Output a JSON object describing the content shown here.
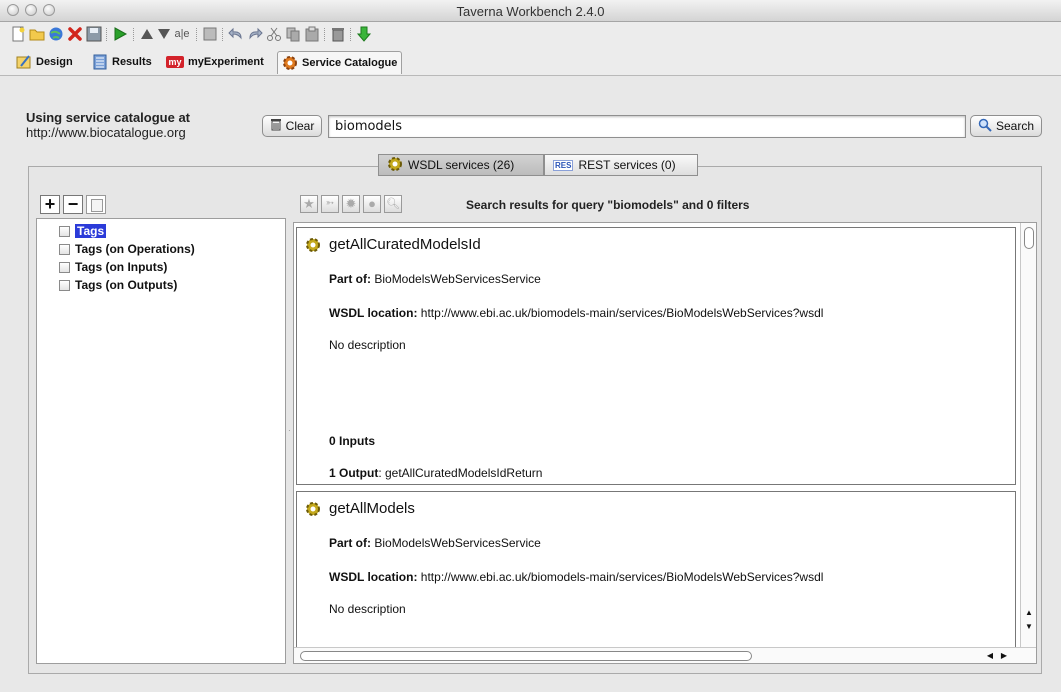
{
  "window": {
    "title": "Taverna Workbench 2.4.0"
  },
  "toolbar": {
    "icons": [
      "new-workflow-icon",
      "open-folder-icon",
      "open-url-icon",
      "close-workflow-icon",
      "save-icon",
      "run-icon",
      "move-up-icon",
      "move-down-icon",
      "rename-icon",
      "add-port-icon",
      "undo-icon",
      "redo-icon",
      "cut-icon",
      "copy-icon",
      "paste-icon",
      "delete-icon",
      "import-icon"
    ]
  },
  "perspectives": [
    {
      "label": "Design",
      "icon": "design-icon"
    },
    {
      "label": "Results",
      "icon": "results-icon"
    },
    {
      "label": "myExperiment",
      "icon": "myexperiment-icon",
      "badge": "my"
    },
    {
      "label": "Service Catalogue",
      "icon": "service-catalogue-icon",
      "active": true
    }
  ],
  "catalogue": {
    "using_label_line1": "Using service catalogue at",
    "using_label_line2": "http://www.biocatalogue.org",
    "clear_label": "Clear",
    "search_value": "biomodels",
    "search_label": "Search"
  },
  "service_tabs": {
    "wsdl": "WSDL services (26)",
    "rest": "REST services (0)",
    "rest_badge": "RES"
  },
  "filter_tree": {
    "items": [
      "Tags",
      "Tags (on Operations)",
      "Tags (on Inputs)",
      "Tags (on Outputs)"
    ]
  },
  "results": {
    "status": "Search results for query \"biomodels\" and 0 filters",
    "cards": [
      {
        "name": "getAllCuratedModelsId",
        "part_of_label": "Part of:",
        "part_of": "BioModelsWebServicesService",
        "wsdl_label": "WSDL location:",
        "wsdl": "http://www.ebi.ac.uk/biomodels-main/services/BioModelsWebServices?wsdl",
        "description": "No description",
        "inputs": "0 Inputs",
        "output_label": "1 Output",
        "output": ": getAllCuratedModelsIdReturn"
      },
      {
        "name": "getAllModels",
        "part_of_label": "Part of:",
        "part_of": "BioModelsWebServicesService",
        "wsdl_label": "WSDL location:",
        "wsdl": "http://www.ebi.ac.uk/biomodels-main/services/BioModelsWebServices?wsdl",
        "description": "No description"
      }
    ]
  },
  "colors": {
    "selection": "#2b3bd9",
    "gear": "#8a7a10",
    "run": "#2aa02a"
  }
}
